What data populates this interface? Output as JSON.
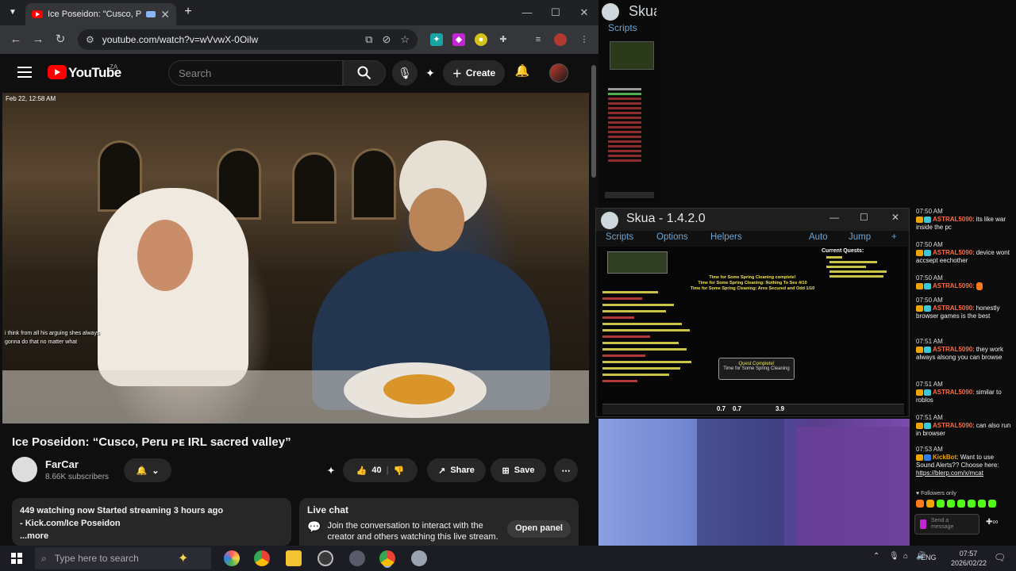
{
  "browser": {
    "tab_title": "Ice Poseidon: \"Cusco, Peru ...",
    "url": "youtube.com/watch?v=wVvwX-0Oilw",
    "new_tab_label": "+"
  },
  "youtube": {
    "logo_text": "YouTube",
    "region": "ZA",
    "search_placeholder": "Search",
    "create_label": "Create",
    "video_timestamp": "Feb 22, 12:58 AM",
    "video_title": "Ice Poseidon: “Cusco, Peru ᴘᴇ IRL sacred valley”",
    "channel_name": "FarCar",
    "subscribers": "8.66K subscribers",
    "likes": "40",
    "share_label": "Share",
    "save_label": "Save",
    "desc_line1": "449 watching now  Started streaming 3 hours ago",
    "desc_line2": "- Kick.com/Ice Poseidon",
    "desc_more": "...more",
    "live_chat_title": "Live chat",
    "live_chat_text": "Join the conversation to interact with the creator and others watching this live stream.",
    "open_panel_label": "Open panel",
    "overlay_chat": [
      "i think from all his arguing shes always",
      "gonna do that no matter what"
    ]
  },
  "skua_small": {
    "title": "Skua",
    "menu": "Scripts"
  },
  "skua_main": {
    "title": "Skua - 1.4.2.0",
    "menu": [
      "Scripts",
      "Options",
      "Helpers"
    ],
    "menu_right": [
      "Auto",
      "Jump",
      "+"
    ],
    "current_quests": "Current Quests:",
    "quest_popup_title": "Quest Complete!",
    "quest_popup_text": "Time for Some Spring Cleaning",
    "center_text1": "Time for Some Spring Cleaning complete!",
    "center_text2": "Time for Some Spring Cleaning: Nothing To See 4/10",
    "center_text3": "Time for Some Spring Cleaning: Ares Secured and Odd 1/10",
    "hotbar_values": [
      "0.7",
      "0.7",
      "3.9"
    ]
  },
  "chat": {
    "messages": [
      {
        "time": "07:50 AM",
        "user": "ASTRAL5090",
        "text": "its like war inside the pc"
      },
      {
        "time": "07:50 AM",
        "user": "ASTRAL5090",
        "text": "device wont accsept eechother"
      },
      {
        "time": "07:50 AM",
        "user": "ASTRAL5090",
        "text": ""
      },
      {
        "time": "07:50 AM",
        "user": "ASTRAL5090",
        "text": "honestly browser games is the best"
      },
      {
        "time": "07:51 AM",
        "user": "ASTRAL5090",
        "text": "they work always alsong you can browse"
      },
      {
        "time": "07:51 AM",
        "user": "ASTRAL5090",
        "text": "similar to roblos"
      },
      {
        "time": "07:51 AM",
        "user": "ASTRAL5090",
        "text": "can also run in browser"
      },
      {
        "time": "07:53 AM",
        "user": "KickBot",
        "text": "Want to use Sound Alerts?? Choose here:",
        "link": "https://blerp.com/x/mcat"
      }
    ],
    "followers_only": "Followers only",
    "send_placeholder": "Send a message"
  },
  "taskbar": {
    "search_placeholder": "Type here to search",
    "language": "ENG",
    "time": "07:57",
    "date": "2026/02/22"
  }
}
